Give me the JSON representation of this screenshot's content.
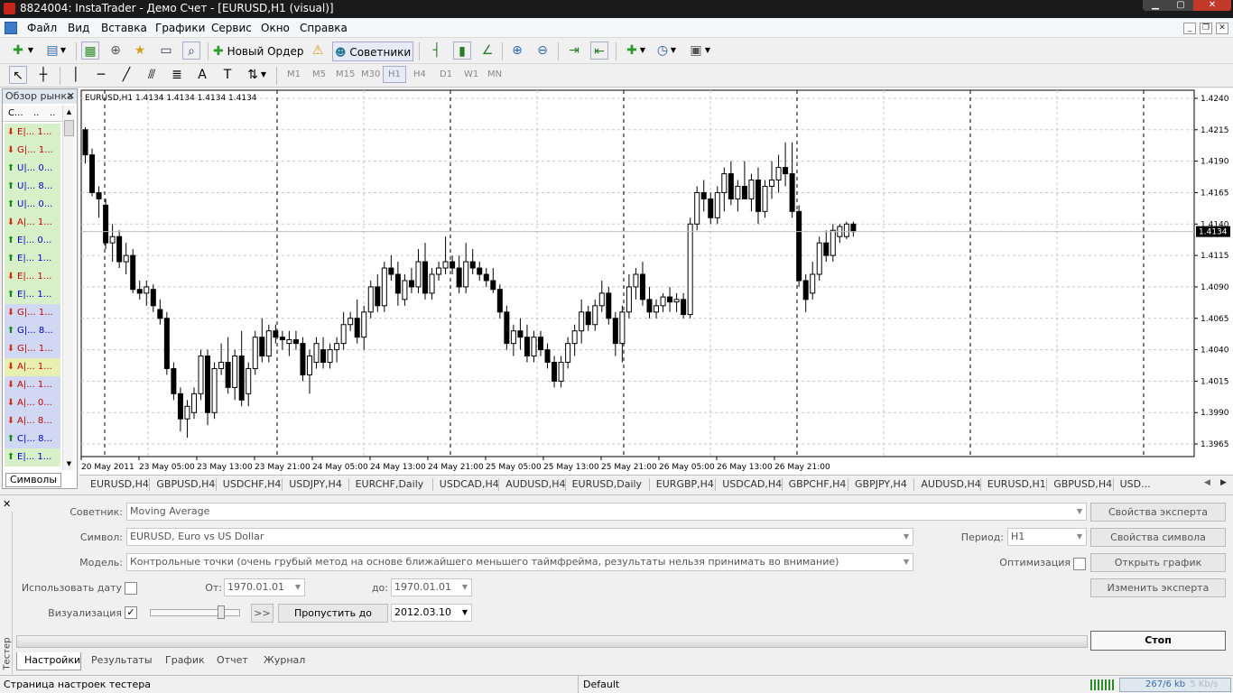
{
  "window": {
    "title": "8824004: InstaTrader - Демо Счет - [EURUSD,H1 (visual)]"
  },
  "menu": [
    "Файл",
    "Вид",
    "Вставка",
    "Графики",
    "Сервис",
    "Окно",
    "Справка"
  ],
  "toolbar": {
    "new_order": "Новый Ордер",
    "experts": "Советники"
  },
  "timeframes": [
    "M1",
    "M5",
    "M15",
    "M30",
    "H1",
    "H4",
    "D1",
    "W1",
    "MN"
  ],
  "market_watch": {
    "title": "Обзор рынка",
    "col_symbol": "С...",
    "col_bid": "..",
    "col_ask": "..",
    "tab": "Символы",
    "rows": [
      {
        "symbol": "E|...",
        "price": "1...",
        "dir": "down",
        "bg": "#d8f0c8",
        "color": "#c00000"
      },
      {
        "symbol": "G|...",
        "price": "1...",
        "dir": "down",
        "bg": "#d8f0c8",
        "color": "#c00000"
      },
      {
        "symbol": "U|...",
        "price": "0...",
        "dir": "up",
        "bg": "#d8f0c8",
        "color": "#0000c0"
      },
      {
        "symbol": "U|...",
        "price": "8...",
        "dir": "up",
        "bg": "#d8f0c8",
        "color": "#0000c0"
      },
      {
        "symbol": "U|...",
        "price": "0...",
        "dir": "up",
        "bg": "#d8f0c8",
        "color": "#0000c0"
      },
      {
        "symbol": "A|...",
        "price": "1...",
        "dir": "down",
        "bg": "#d8f0c8",
        "color": "#c00000"
      },
      {
        "symbol": "E|...",
        "price": "0...",
        "dir": "up",
        "bg": "#d8f0c8",
        "color": "#0000c0"
      },
      {
        "symbol": "E|...",
        "price": "1...",
        "dir": "up",
        "bg": "#d8f0c8",
        "color": "#0000c0"
      },
      {
        "symbol": "E|...",
        "price": "1...",
        "dir": "down",
        "bg": "#d8f0c8",
        "color": "#c00000"
      },
      {
        "symbol": "E|...",
        "price": "1...",
        "dir": "up",
        "bg": "#d8f0c8",
        "color": "#0000c0"
      },
      {
        "symbol": "G|...",
        "price": "1...",
        "dir": "down",
        "bg": "#d0d8f4",
        "color": "#c00000"
      },
      {
        "symbol": "G|...",
        "price": "8...",
        "dir": "up",
        "bg": "#d0d8f4",
        "color": "#0000c0"
      },
      {
        "symbol": "G|...",
        "price": "1...",
        "dir": "down",
        "bg": "#d0d8f4",
        "color": "#c00000"
      },
      {
        "symbol": "A|...",
        "price": "1...",
        "dir": "down",
        "bg": "#e8f0b0",
        "color": "#c00000"
      },
      {
        "symbol": "A|...",
        "price": "1...",
        "dir": "down",
        "bg": "#d0d8f4",
        "color": "#c00000"
      },
      {
        "symbol": "A|...",
        "price": "0...",
        "dir": "down",
        "bg": "#d0d8f4",
        "color": "#c00000"
      },
      {
        "symbol": "A|...",
        "price": "8...",
        "dir": "down",
        "bg": "#d0d8f4",
        "color": "#c00000"
      },
      {
        "symbol": "C|...",
        "price": "8...",
        "dir": "up",
        "bg": "#d0d8f4",
        "color": "#0000c0"
      },
      {
        "symbol": "E|...",
        "price": "1...",
        "dir": "up",
        "bg": "#d8f0c8",
        "color": "#0000c0"
      }
    ]
  },
  "chart": {
    "header": "EURUSD,H1  1.4134 1.4134 1.4134 1.4134",
    "current_price": "1.4134"
  },
  "chart_data": {
    "type": "candlestick",
    "symbol": "EURUSD",
    "timeframe": "H1",
    "y_ticks": [
      "1.4240",
      "1.4215",
      "1.4190",
      "1.4165",
      "1.4140",
      "1.4115",
      "1.4090",
      "1.4065",
      "1.4040",
      "1.4015",
      "1.3990",
      "1.3965"
    ],
    "ylim": [
      1.3965,
      1.424
    ],
    "x_ticks": [
      "20 May 2011",
      "23 May 05:00",
      "23 May 13:00",
      "23 May 21:00",
      "24 May 05:00",
      "24 May 13:00",
      "24 May 21:00",
      "25 May 05:00",
      "25 May 13:00",
      "25 May 21:00",
      "26 May 05:00",
      "26 May 13:00",
      "26 May 21:00"
    ],
    "current_price": 1.4134,
    "grid": true,
    "candles": [
      [
        1.4215,
        1.4217,
        1.4188,
        1.4195
      ],
      [
        1.4195,
        1.42,
        1.4162,
        1.4165
      ],
      [
        1.4165,
        1.417,
        1.4145,
        1.416
      ],
      [
        1.4155,
        1.416,
        1.412,
        1.4125
      ],
      [
        1.4125,
        1.414,
        1.411,
        1.413
      ],
      [
        1.413,
        1.4135,
        1.4105,
        1.411
      ],
      [
        1.411,
        1.4125,
        1.41,
        1.4115
      ],
      [
        1.4115,
        1.412,
        1.4085,
        1.4088
      ],
      [
        1.4088,
        1.4095,
        1.408,
        1.4085
      ],
      [
        1.4085,
        1.4095,
        1.4075,
        1.409
      ],
      [
        1.4088,
        1.4092,
        1.407,
        1.4075
      ],
      [
        1.4072,
        1.408,
        1.406,
        1.4065
      ],
      [
        1.4065,
        1.407,
        1.402,
        1.4025
      ],
      [
        1.4025,
        1.403,
        1.4,
        1.4005
      ],
      [
        1.4005,
        1.401,
        1.3975,
        1.3985
      ],
      [
        1.3985,
        1.4,
        1.397,
        1.3995
      ],
      [
        1.399,
        1.401,
        1.3985,
        1.4005
      ],
      [
        1.4005,
        1.404,
        1.4,
        1.4035
      ],
      [
        1.4035,
        1.404,
        1.398,
        1.399
      ],
      [
        1.399,
        1.403,
        1.3985,
        1.4025
      ],
      [
        1.4025,
        1.4045,
        1.402,
        1.403
      ],
      [
        1.403,
        1.405,
        1.4005,
        1.401
      ],
      [
        1.401,
        1.404,
        1.4,
        1.4035
      ],
      [
        1.4035,
        1.4055,
        1.3995,
        1.4
      ],
      [
        1.4005,
        1.403,
        1.3995,
        1.4025
      ],
      [
        1.4025,
        1.4055,
        1.402,
        1.405
      ],
      [
        1.405,
        1.4065,
        1.403,
        1.4035
      ],
      [
        1.4035,
        1.406,
        1.403,
        1.4055
      ],
      [
        1.4055,
        1.406,
        1.4045,
        1.405
      ],
      [
        1.405,
        1.4055,
        1.404,
        1.4048
      ],
      [
        1.4045,
        1.4055,
        1.4035,
        1.4048
      ],
      [
        1.4048,
        1.4055,
        1.404,
        1.4045
      ],
      [
        1.4045,
        1.405,
        1.4015,
        1.402
      ],
      [
        1.402,
        1.404,
        1.4005,
        1.4035
      ],
      [
        1.403,
        1.405,
        1.4025,
        1.4045
      ],
      [
        1.404,
        1.405,
        1.4025,
        1.403
      ],
      [
        1.403,
        1.4045,
        1.4025,
        1.404
      ],
      [
        1.404,
        1.405,
        1.403,
        1.4045
      ],
      [
        1.4045,
        1.407,
        1.404,
        1.406
      ],
      [
        1.406,
        1.407,
        1.4055,
        1.4065
      ],
      [
        1.4065,
        1.408,
        1.4045,
        1.405
      ],
      [
        1.405,
        1.4075,
        1.404,
        1.407
      ],
      [
        1.407,
        1.4095,
        1.4065,
        1.409
      ],
      [
        1.409,
        1.41,
        1.407,
        1.4075
      ],
      [
        1.4075,
        1.411,
        1.407,
        1.4105
      ],
      [
        1.4105,
        1.4115,
        1.4095,
        1.41
      ],
      [
        1.41,
        1.411,
        1.4075,
        1.4085
      ],
      [
        1.408,
        1.41,
        1.4075,
        1.4095
      ],
      [
        1.4095,
        1.4105,
        1.4085,
        1.409
      ],
      [
        1.409,
        1.412,
        1.4085,
        1.411
      ],
      [
        1.411,
        1.4125,
        1.408,
        1.4085
      ],
      [
        1.4085,
        1.4105,
        1.408,
        1.41
      ],
      [
        1.41,
        1.411,
        1.4095,
        1.4105
      ],
      [
        1.4105,
        1.413,
        1.41,
        1.411
      ],
      [
        1.411,
        1.4115,
        1.41,
        1.4105
      ],
      [
        1.4105,
        1.4115,
        1.4085,
        1.409
      ],
      [
        1.409,
        1.4125,
        1.4085,
        1.411
      ],
      [
        1.411,
        1.412,
        1.41,
        1.4105
      ],
      [
        1.4105,
        1.411,
        1.4095,
        1.41
      ],
      [
        1.41,
        1.4105,
        1.409,
        1.4095
      ],
      [
        1.4095,
        1.4105,
        1.4085,
        1.4088
      ],
      [
        1.4088,
        1.4092,
        1.4065,
        1.407
      ],
      [
        1.407,
        1.4075,
        1.404,
        1.4045
      ],
      [
        1.4045,
        1.406,
        1.4035,
        1.4055
      ],
      [
        1.4055,
        1.4065,
        1.404,
        1.405
      ],
      [
        1.405,
        1.406,
        1.403,
        1.4035
      ],
      [
        1.4035,
        1.4055,
        1.403,
        1.405
      ],
      [
        1.405,
        1.4055,
        1.4035,
        1.404
      ],
      [
        1.404,
        1.4045,
        1.4025,
        1.403
      ],
      [
        1.403,
        1.4035,
        1.401,
        1.4015
      ],
      [
        1.4015,
        1.4035,
        1.401,
        1.403
      ],
      [
        1.403,
        1.405,
        1.4025,
        1.4045
      ],
      [
        1.4045,
        1.406,
        1.4035,
        1.4055
      ],
      [
        1.4055,
        1.408,
        1.4045,
        1.407
      ],
      [
        1.407,
        1.4075,
        1.4055,
        1.406
      ],
      [
        1.406,
        1.408,
        1.4055,
        1.4075
      ],
      [
        1.4075,
        1.4095,
        1.407,
        1.4085
      ],
      [
        1.4085,
        1.409,
        1.406,
        1.4065
      ],
      [
        1.4065,
        1.407,
        1.4035,
        1.4045
      ],
      [
        1.4045,
        1.4075,
        1.403,
        1.407
      ],
      [
        1.407,
        1.41,
        1.4065,
        1.409
      ],
      [
        1.409,
        1.4105,
        1.408,
        1.41
      ],
      [
        1.41,
        1.411,
        1.4075,
        1.408
      ],
      [
        1.408,
        1.409,
        1.4065,
        1.407
      ],
      [
        1.407,
        1.408,
        1.4065,
        1.4075
      ],
      [
        1.4075,
        1.4085,
        1.407,
        1.4082
      ],
      [
        1.4082,
        1.409,
        1.407,
        1.4078
      ],
      [
        1.4078,
        1.4085,
        1.407,
        1.408
      ],
      [
        1.408,
        1.4085,
        1.4065,
        1.4068
      ],
      [
        1.4068,
        1.4145,
        1.4065,
        1.414
      ],
      [
        1.414,
        1.417,
        1.4135,
        1.4165
      ],
      [
        1.4165,
        1.4175,
        1.415,
        1.416
      ],
      [
        1.416,
        1.4165,
        1.414,
        1.4145
      ],
      [
        1.4145,
        1.417,
        1.414,
        1.4165
      ],
      [
        1.4165,
        1.4185,
        1.415,
        1.418
      ],
      [
        1.418,
        1.419,
        1.4155,
        1.416
      ],
      [
        1.416,
        1.4175,
        1.415,
        1.417
      ],
      [
        1.417,
        1.419,
        1.416,
        1.416
      ],
      [
        1.416,
        1.418,
        1.415,
        1.4175
      ],
      [
        1.4175,
        1.4185,
        1.414,
        1.415
      ],
      [
        1.415,
        1.4175,
        1.4145,
        1.417
      ],
      [
        1.417,
        1.419,
        1.416,
        1.4175
      ],
      [
        1.4175,
        1.4195,
        1.4165,
        1.4185
      ],
      [
        1.4185,
        1.4205,
        1.417,
        1.418
      ],
      [
        1.418,
        1.4205,
        1.4145,
        1.415
      ],
      [
        1.415,
        1.4155,
        1.409,
        1.4095
      ],
      [
        1.4095,
        1.41,
        1.407,
        1.408
      ],
      [
        1.4085,
        1.411,
        1.408,
        1.41
      ],
      [
        1.41,
        1.413,
        1.4095,
        1.4125
      ],
      [
        1.4125,
        1.4135,
        1.411,
        1.4115
      ],
      [
        1.4115,
        1.414,
        1.411,
        1.4135
      ],
      [
        1.413,
        1.414,
        1.4125,
        1.4138
      ],
      [
        1.413,
        1.4142,
        1.4128,
        1.414
      ],
      [
        1.414,
        1.4142,
        1.413,
        1.4134
      ]
    ]
  },
  "chart_tabs": [
    "EURUSD,H4",
    "GBPUSD,H4",
    "USDCHF,H4",
    "USDJPY,H4",
    "EURCHF,Daily",
    "USDCAD,H4",
    "AUDUSD,H4",
    "EURUSD,Daily",
    "EURGBP,H4",
    "USDCAD,H4",
    "GBPCHF,H4",
    "GBPJPY,H4",
    "AUDUSD,H4",
    "EURUSD,H1",
    "GBPUSD,H4",
    "USD..."
  ],
  "tester": {
    "side_label": "Тестер",
    "expert_label": "Советник:",
    "expert_value": "Moving Average",
    "symbol_label": "Символ:",
    "symbol_value": "EURUSD, Euro vs US Dollar",
    "period_label": "Период:",
    "period_value": "H1",
    "model_label": "Модель:",
    "model_value": "Контрольные точки (очень грубый метод на основе ближайшего меньшего таймфрейма, результаты нельзя принимать во внимание)",
    "optimization_label": "Оптимизация",
    "use_date_label": "Использовать дату",
    "from_label": "От:",
    "from_value": "1970.01.01",
    "to_label": "до:",
    "to_value": "1970.01.01",
    "visual_label": "Визуализация",
    "skip_button": ">>",
    "skip_to_label": "Пропустить до",
    "skip_to_value": "2012.03.10",
    "btn_expert_props": "Свойства эксперта",
    "btn_symbol_props": "Свойства символа",
    "btn_open_chart": "Открыть график",
    "btn_modify_expert": "Изменить эксперта",
    "btn_stop": "Стоп",
    "tabs": [
      "Настройки",
      "Результаты",
      "График",
      "Отчет",
      "Журнал"
    ]
  },
  "status": {
    "left": "Страница настроек тестера",
    "profile": "Default",
    "traffic": "267/6 kb",
    "traffic2": "5 Kb/s"
  }
}
